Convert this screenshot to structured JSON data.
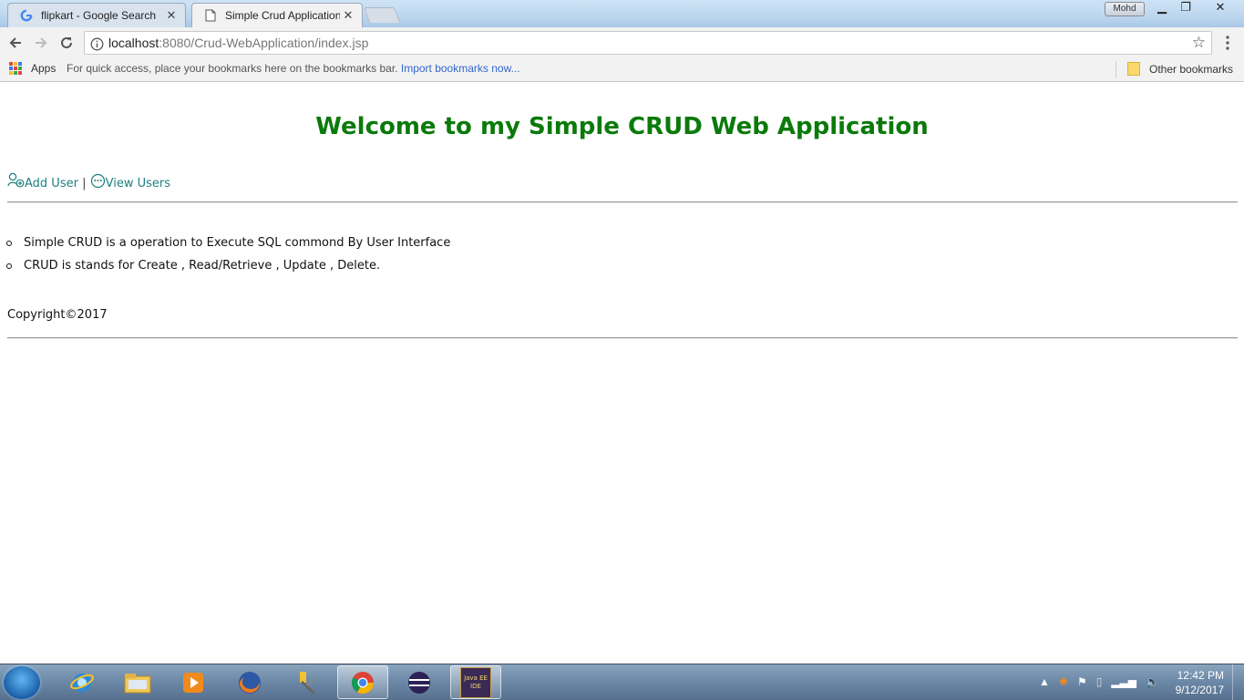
{
  "browser": {
    "tabs": [
      {
        "title": "flipkart - Google Search",
        "icon": "google-icon",
        "active": false
      },
      {
        "title": "Simple Crud Application",
        "icon": "page-icon",
        "active": true
      }
    ],
    "profile_name": "Mohd",
    "address": {
      "host": "localhost",
      "path": ":8080/Crud-WebApplication/index.jsp"
    },
    "bookmarks_bar": {
      "apps_label": "Apps",
      "hint_text": "For quick access, place your bookmarks here on the bookmarks bar.",
      "import_link": "Import bookmarks now...",
      "other_bookmarks": "Other bookmarks"
    }
  },
  "page": {
    "heading": "Welcome to my Simple CRUD Web Application",
    "nav": {
      "add_user": "Add User",
      "separator": "|",
      "view_users": "View Users"
    },
    "info_items": [
      "Simple CRUD is a operation to Execute SQL commond By User Interface",
      "CRUD is stands for Create , Read/Retrieve , Update , Delete."
    ],
    "copyright": "Copyright©2017"
  },
  "taskbar": {
    "apps": [
      "internet-explorer",
      "file-explorer",
      "media-player",
      "firefox",
      "tool",
      "chrome",
      "eclipse",
      "java-ee-ide"
    ],
    "java_ide_label_1": "Java EE",
    "java_ide_label_2": "IDE",
    "clock_time": "12:42 PM",
    "clock_date": "9/12/2017"
  },
  "colors": {
    "heading": "#0a7a0a",
    "link": "#1f7f7f",
    "link_bookmark": "#3366cc"
  }
}
